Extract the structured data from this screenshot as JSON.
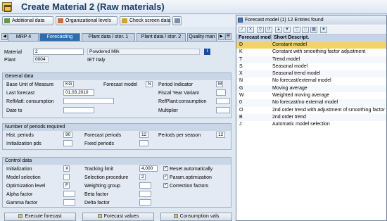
{
  "window": {
    "title": "Create Material 2 (Raw materials)"
  },
  "toolbar": {
    "additional_data": "Additional data",
    "org_levels": "Organizational levels",
    "check_screen_data": "Check screen data"
  },
  "tabs": [
    "MRP 4",
    "Forecasting",
    "Plant data / stor. 1",
    "Plant data / stor. 2",
    "Quality man"
  ],
  "header": {
    "material_label": "Material",
    "material_value": "2",
    "material_desc": "Powdered Milk",
    "plant_label": "Plant",
    "plant_value": "0004",
    "plant_desc": "IET Italy"
  },
  "general": {
    "title": "General data",
    "base_uom_label": "Base Unit of Measure",
    "base_uom_value": "KG",
    "forecast_model_label": "Forecast model",
    "forecast_model_value": "N",
    "period_indicator_label": "Period Indicator",
    "period_indicator_value": "M",
    "last_forecast_label": "Last forecast",
    "last_forecast_value": "01.03.2010",
    "fiscal_year_variant_label": "Fiscal Year Variant",
    "refmatl_label": "RefMatl: consumption",
    "refplant_label": "RefPlant:consumption",
    "date_to_label": "Date to",
    "multiplier_label": "Multiplier"
  },
  "periods": {
    "title": "Number of periods required",
    "hist_label": "Hist. periods",
    "hist_value": "90",
    "forecast_label": "Forecast periods",
    "forecast_value": "12",
    "per_season_label": "Periods per season",
    "per_season_value": "12",
    "init_label": "Initialization pds",
    "fixed_label": "Fixed periods"
  },
  "control": {
    "title": "Control data",
    "init_label": "Initialization",
    "init_value": "X",
    "tracking_label": "Tracking limit",
    "tracking_value": "4,000",
    "reset_label": "Reset automatically",
    "model_sel_label": "Model selection",
    "sel_proc_label": "Selection procedure",
    "sel_proc_value": "2",
    "param_opt_label": "Param.optimization",
    "opt_level_label": "Optimization level",
    "opt_level_value": "F",
    "weighting_label": "Weighting group",
    "correction_label": "Correction factors",
    "alpha_label": "Alpha factor",
    "beta_label": "Beta factor",
    "gamma_label": "Gamma factor",
    "delta_label": "Delta factor",
    "reset_checked": true,
    "param_opt_checked": true,
    "correction_checked": true
  },
  "bottom_buttons": {
    "execute": "Execute forecast",
    "values": "Forecast values",
    "consumption": "Consumption vals"
  },
  "popup": {
    "title": "Forecast model (1)   12 Entries found",
    "col_key": "Forecast mod",
    "col_desc": "Short Descript.",
    "rows": [
      {
        "key": "D",
        "desc": "Constant model"
      },
      {
        "key": "K",
        "desc": "Constant with smoothing factor adjustment"
      },
      {
        "key": "T",
        "desc": "Trend model"
      },
      {
        "key": "S",
        "desc": "Seasonal model"
      },
      {
        "key": "X",
        "desc": "Seasonal trend model"
      },
      {
        "key": "N",
        "desc": "No forecast/external model"
      },
      {
        "key": "G",
        "desc": "Moving average"
      },
      {
        "key": "W",
        "desc": "Weighted moving average"
      },
      {
        "key": "0",
        "desc": "No forecast/no external model"
      },
      {
        "key": "O",
        "desc": "2nd order trend with adjustment of smoothing factor"
      },
      {
        "key": "B",
        "desc": "2nd order trend"
      },
      {
        "key": "J",
        "desc": "Automatic model selection"
      }
    ]
  }
}
